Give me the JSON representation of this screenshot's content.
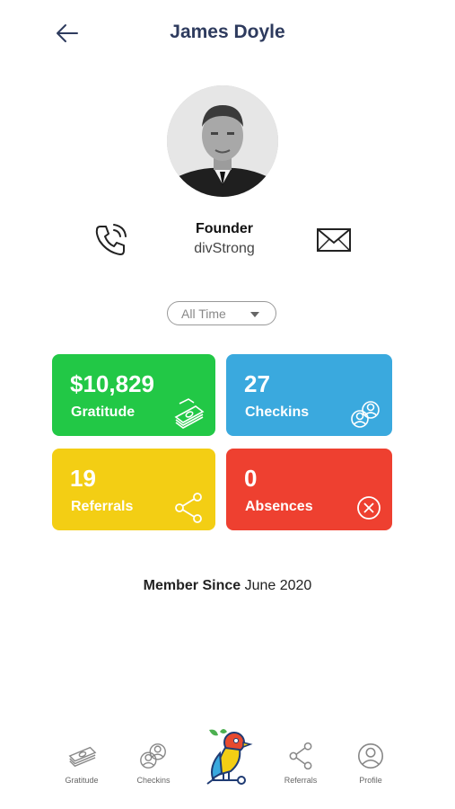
{
  "header": {
    "title": "James Doyle",
    "back_icon": "arrow-left-icon"
  },
  "profile": {
    "role": "Founder",
    "company": "divStrong",
    "phone_icon": "phone-icon",
    "mail_icon": "mail-icon"
  },
  "filter": {
    "selected": "All Time"
  },
  "stats": [
    {
      "value": "$10,829",
      "label": "Gratitude",
      "color": "#22c846",
      "icon": "cash-icon"
    },
    {
      "value": "27",
      "label": "Checkins",
      "color": "#3aa9de",
      "icon": "users-icon"
    },
    {
      "value": "19",
      "label": "Referrals",
      "color": "#f3ce14",
      "icon": "share-icon"
    },
    {
      "value": "0",
      "label": "Absences",
      "color": "#ee4030",
      "icon": "close-circle-icon"
    }
  ],
  "member": {
    "prefix": "Member Since",
    "date": "June 2020"
  },
  "nav": {
    "items": [
      {
        "label": "Gratitude",
        "icon": "cash-icon"
      },
      {
        "label": "Checkins",
        "icon": "users-icon"
      },
      {
        "label": "",
        "icon": "bird-logo-icon"
      },
      {
        "label": "Referrals",
        "icon": "share-icon"
      },
      {
        "label": "Profile",
        "icon": "user-icon"
      }
    ]
  }
}
